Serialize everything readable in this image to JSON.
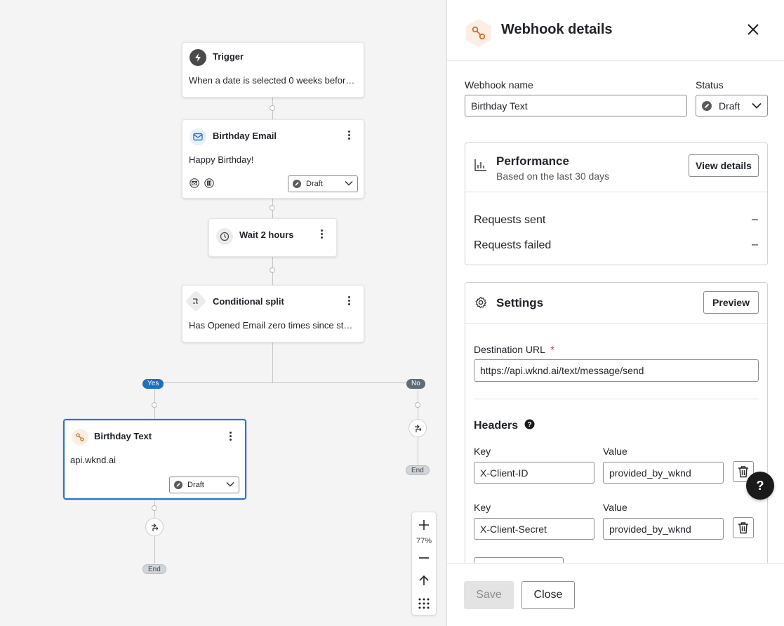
{
  "flow": {
    "trigger": {
      "title": "Trigger",
      "body": "When a date is selected 0 weeks before ..."
    },
    "email": {
      "title": "Birthday Email",
      "body": "Happy Birthday!",
      "status": "Draft"
    },
    "wait": {
      "title": "Wait 2 hours"
    },
    "split": {
      "title": "Conditional split",
      "body": "Has Opened Email zero times since starti..."
    },
    "branches": {
      "yes": "Yes",
      "no": "No"
    },
    "webhook": {
      "title": "Birthday Text",
      "body": "api.wknd.ai",
      "status": "Draft"
    },
    "end_left": "End",
    "end_right": "End"
  },
  "zoom": {
    "level": "77%"
  },
  "panel": {
    "title": "Webhook details",
    "webhook_name_label": "Webhook name",
    "webhook_name_value": "Birthday Text",
    "status_label": "Status",
    "status_value": "Draft",
    "performance": {
      "title": "Performance",
      "subtitle": "Based on the last 30 days",
      "button": "View details",
      "metrics": [
        {
          "label": "Requests sent",
          "value": "–"
        },
        {
          "label": "Requests failed",
          "value": "–"
        }
      ]
    },
    "settings": {
      "title": "Settings",
      "button": "Preview",
      "destination_label": "Destination URL",
      "required_mark": "*",
      "destination_value": "https://api.wknd.ai/text/message/send",
      "headers_title": "Headers",
      "headers": [
        {
          "key_label": "Key",
          "value_label": "Value",
          "key": "X-Client-ID",
          "value": "provided_by_wknd"
        },
        {
          "key_label": "Key",
          "value_label": "Value",
          "key": "X-Client-Secret",
          "value": "provided_by_wknd"
        }
      ]
    },
    "save": "Save",
    "close": "Close"
  },
  "help": {
    "label": "?"
  },
  "colors": {
    "accent_blue": "#2a73c5",
    "webhook_orange": "#d4692a",
    "yes_pill": "#1f6fbf",
    "no_pill": "#5f6b76"
  }
}
